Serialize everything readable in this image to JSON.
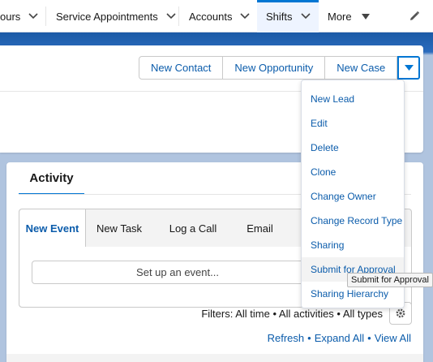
{
  "nav": {
    "items": [
      {
        "label": "ours"
      },
      {
        "label": "Service Appointments"
      },
      {
        "label": "Accounts"
      },
      {
        "label": "Shifts"
      },
      {
        "label": "More"
      }
    ]
  },
  "actions": {
    "new_contact": "New Contact",
    "new_opportunity": "New Opportunity",
    "new_case": "New Case"
  },
  "menu": {
    "items": [
      "New Lead",
      "Edit",
      "Delete",
      "Clone",
      "Change Owner",
      "Change Record Type",
      "Sharing",
      "Submit for Approval",
      "Sharing Hierarchy"
    ],
    "tooltip": "Submit for Approval"
  },
  "activity": {
    "title": "Activity",
    "tabs": [
      "New Event",
      "New Task",
      "Log a Call",
      "Email"
    ],
    "setup_label": "Set up an event...",
    "filters": "Filters: All time • All activities • All types",
    "links": {
      "refresh": "Refresh",
      "expand_all": "Expand All",
      "view_all": "View All"
    }
  },
  "colors": {
    "brand": "#0176d3",
    "link": "#0b5cab",
    "banner": "#b0c4df"
  }
}
